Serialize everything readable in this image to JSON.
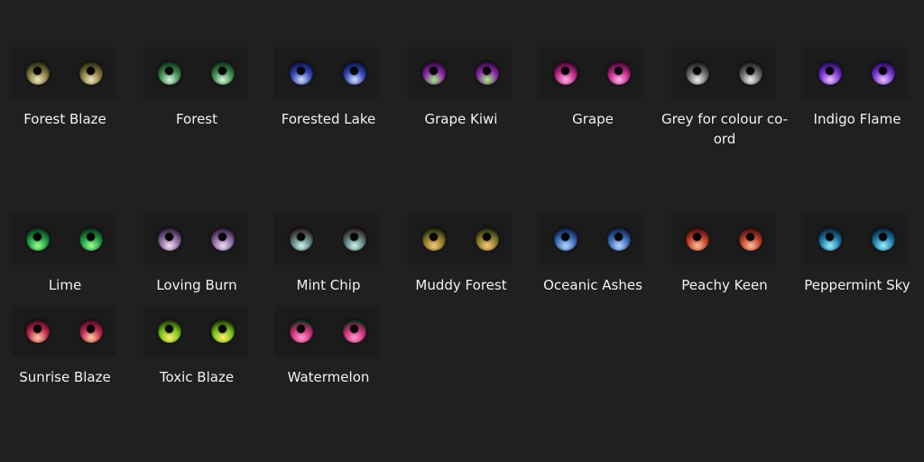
{
  "items": [
    {
      "label": "Forest Blaze",
      "colors": [
        "#1f2a14",
        "#8a7a40",
        "#f0e6c0"
      ]
    },
    {
      "label": "Forest",
      "colors": [
        "#10301a",
        "#3f8a4f",
        "#d9f5df"
      ]
    },
    {
      "label": "Forested Lake",
      "colors": [
        "#0c1440",
        "#3446b4",
        "#d6ddff"
      ]
    },
    {
      "label": "Grape Kiwi",
      "colors": [
        "#2c0c3a",
        "#8e2aa8",
        "#9ef07a"
      ]
    },
    {
      "label": "Grape",
      "colors": [
        "#3a0a2c",
        "#c2298a",
        "#ffb3e6"
      ]
    },
    {
      "label": "Grey for colour co-ord",
      "colors": [
        "#1a1a1a",
        "#6b6b6b",
        "#f0f0f0"
      ]
    },
    {
      "label": "Indigo Flame",
      "colors": [
        "#1c0c4a",
        "#7b35d6",
        "#eac2ff"
      ]
    },
    {
      "label": "Lime",
      "colors": [
        "#0c2a14",
        "#1f9a45",
        "#9dff90"
      ]
    },
    {
      "label": "Loving Burn",
      "colors": [
        "#2a1a30",
        "#8a6aa0",
        "#f2dcf5"
      ]
    },
    {
      "label": "Mint Chip",
      "colors": [
        "#2a1818",
        "#5f7a78",
        "#c6f5ef"
      ]
    },
    {
      "label": "Muddy Forest",
      "colors": [
        "#1c2410",
        "#8a7a2a",
        "#f5c878"
      ]
    },
    {
      "label": "Oceanic Ashes",
      "colors": [
        "#0e1e40",
        "#3a6ab8",
        "#b8d6ff"
      ]
    },
    {
      "label": "Peachy Keen",
      "colors": [
        "#3a0e0e",
        "#c2402c",
        "#ffbe9a"
      ]
    },
    {
      "label": "Peppermint Sky",
      "colors": [
        "#0c2030",
        "#1e7aa8",
        "#9af0ff"
      ]
    },
    {
      "label": "Sunrise Blaze",
      "colors": [
        "#3a0c1e",
        "#c22a50",
        "#ffd0a0"
      ]
    },
    {
      "label": "Toxic Blaze",
      "colors": [
        "#1e3008",
        "#7ac21e",
        "#fff06a"
      ]
    },
    {
      "label": "Watermelon",
      "colors": [
        "#0c3018",
        "#d1307a",
        "#ff9ad0"
      ]
    }
  ]
}
